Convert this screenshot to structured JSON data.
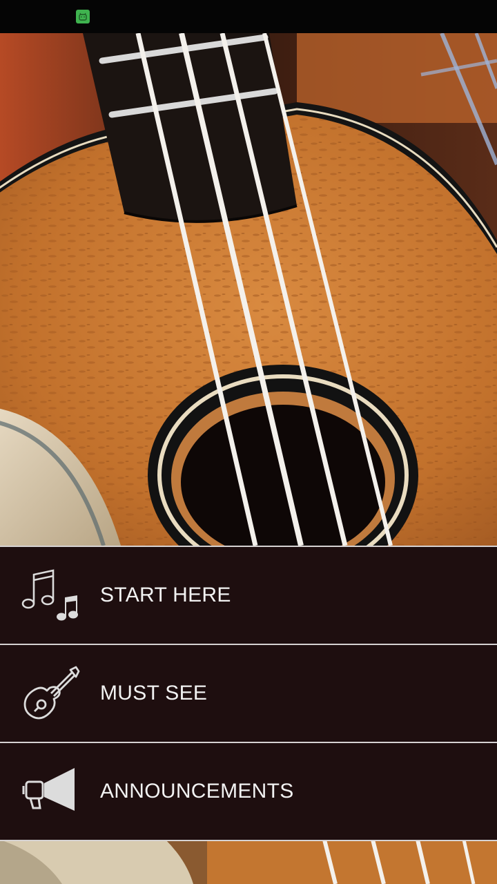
{
  "status_bar": {
    "notification_icon": "android-robot-icon",
    "accent": "#3fb34f"
  },
  "hero": {
    "image_subject": "ukulele-closeup-image"
  },
  "menu": {
    "items": [
      {
        "label": "START HERE",
        "icon": "music-notes-icon"
      },
      {
        "label": "MUST SEE",
        "icon": "ukulele-icon"
      },
      {
        "label": "ANNOUNCEMENTS",
        "icon": "megaphone-icon"
      }
    ]
  },
  "colors": {
    "menu_background": "#1e0e0f",
    "menu_divider": "#d6d2d2",
    "menu_text": "#f2f2f2",
    "wood": "#c87a35"
  }
}
